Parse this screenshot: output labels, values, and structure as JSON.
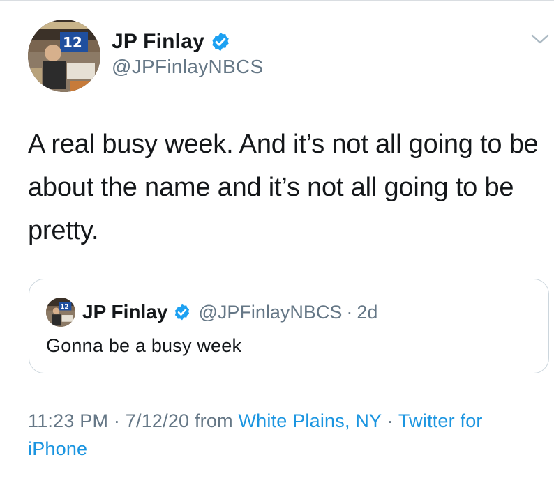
{
  "tweet": {
    "author": {
      "display_name": "JP Finlay",
      "handle": "@JPFinlayNBCS",
      "verified": true,
      "avatar_icon": "profile-photo"
    },
    "text": "A real busy week. And it’s not all going to be about the name and it’s not all going to be pretty.",
    "menu_icon": "chevron-down-icon",
    "quoted": {
      "display_name": "JP Finlay",
      "handle": "@JPFinlayNBCS",
      "separator": "·",
      "time": "2d",
      "text": "Gonna be a busy week"
    },
    "meta": {
      "time": "11:23 PM",
      "date": "7/12/20",
      "from_label": "from",
      "location": "White Plains, NY",
      "separator": "·",
      "source": "Twitter for iPhone"
    }
  },
  "colors": {
    "text_primary": "#14171a",
    "text_secondary": "#657786",
    "link": "#1b95e0",
    "verified_badge": "#1da1f2",
    "border": "#ccd6dd"
  }
}
